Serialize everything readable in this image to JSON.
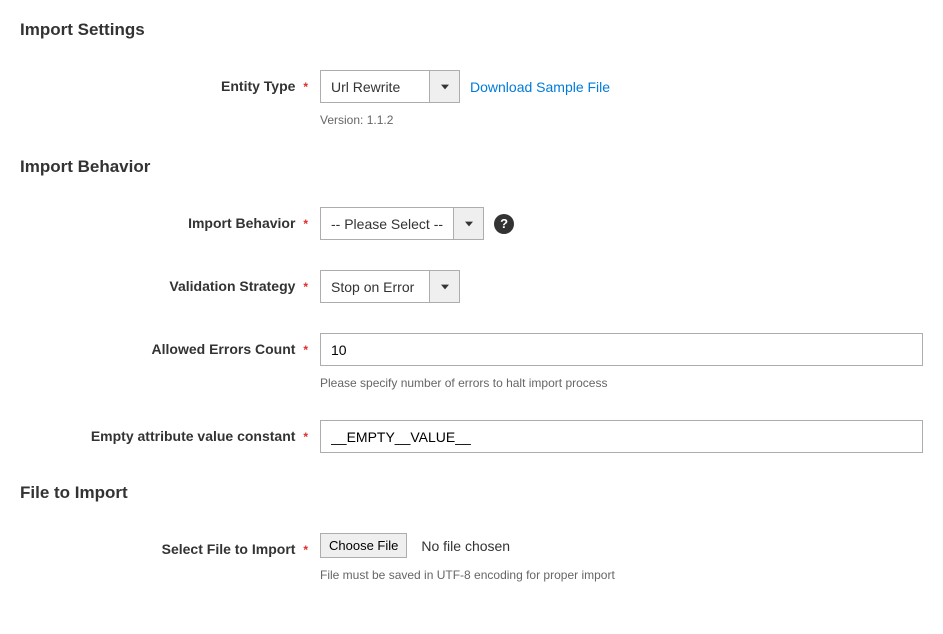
{
  "sections": {
    "import_settings": {
      "title": "Import Settings"
    },
    "import_behavior": {
      "title": "Import Behavior"
    },
    "file_to_import": {
      "title": "File to Import"
    }
  },
  "entity_type": {
    "label": "Entity Type",
    "value": "Url Rewrite",
    "download_link": "Download Sample File",
    "version": "Version: 1.1.2"
  },
  "behavior_field": {
    "label": "Import Behavior",
    "value": "-- Please Select --"
  },
  "validation_strategy": {
    "label": "Validation Strategy",
    "value": "Stop on Error"
  },
  "allowed_errors": {
    "label": "Allowed Errors Count",
    "value": "10",
    "note": "Please specify number of errors to halt import process"
  },
  "empty_attribute": {
    "label": "Empty attribute value constant",
    "value": "__EMPTY__VALUE__"
  },
  "select_file": {
    "label": "Select File to Import",
    "button": "Choose File",
    "status": "No file chosen",
    "note": "File must be saved in UTF-8 encoding for proper import"
  },
  "required_mark": "*"
}
